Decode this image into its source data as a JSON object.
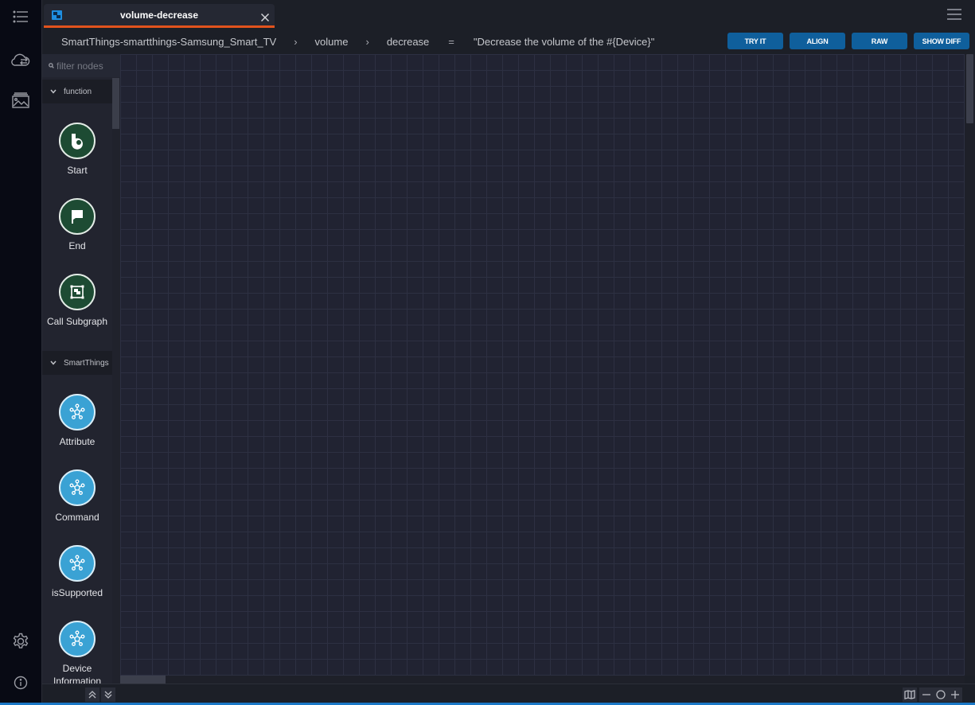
{
  "rail": {
    "items": [
      {
        "name": "list-icon"
      },
      {
        "name": "cloud-sync-icon"
      },
      {
        "name": "gallery-icon"
      },
      {
        "name": "settings-icon"
      },
      {
        "name": "info-icon"
      }
    ]
  },
  "tab": {
    "title": "volume-decrease",
    "icon": "subgraph-icon",
    "close_icon": "close-icon"
  },
  "breadcrumb": {
    "device": "SmartThings-smartthings-Samsung_Smart_TV",
    "separator": "›",
    "capability": "volume",
    "command": "decrease",
    "equals": "=",
    "description": "\"Decrease the volume of the #{Device}\""
  },
  "toolbar": {
    "try_it": "TRY IT",
    "align": "ALIGN",
    "raw": "RAW",
    "show_diff": "SHOW DIFF",
    "accent": "#0f5f9c"
  },
  "palette": {
    "search_placeholder": "filter nodes",
    "sections": [
      {
        "title": "function",
        "nodes": [
          {
            "label": "Start",
            "icon": "bixby-icon",
            "color": "#1d4b33"
          },
          {
            "label": "End",
            "icon": "flag-icon",
            "color": "#1d4b33"
          },
          {
            "label": "Call Subgraph",
            "icon": "subgraph-icon",
            "color": "#1d4b33"
          }
        ]
      },
      {
        "title": "SmartThings",
        "nodes": [
          {
            "label": "Attribute",
            "icon": "hub-icon",
            "color": "#3aa2d4"
          },
          {
            "label": "Command",
            "icon": "hub-icon",
            "color": "#3aa2d4"
          },
          {
            "label": "isSupported",
            "icon": "hub-icon",
            "color": "#3aa2d4"
          },
          {
            "label": "Device Information",
            "icon": "hub-icon",
            "color": "#3aa2d4"
          }
        ]
      }
    ]
  },
  "colors": {
    "tab_underline": "#e2531d",
    "status_bar": "#1b78c6"
  }
}
